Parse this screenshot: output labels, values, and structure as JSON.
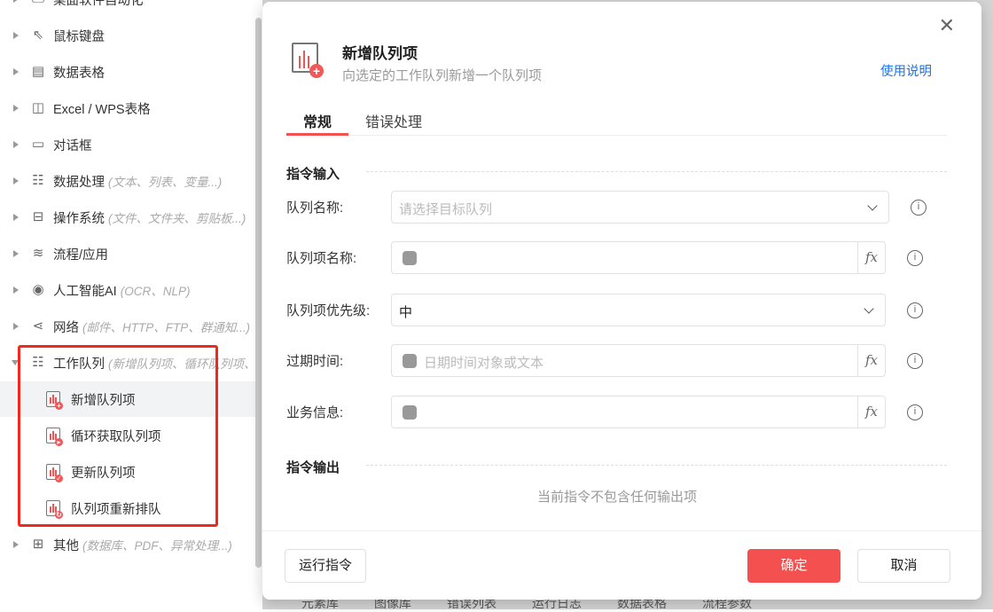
{
  "sidebar": {
    "items": [
      {
        "label": "桌面软件自动化",
        "hint": "",
        "icon": "monitor-icon"
      },
      {
        "label": "鼠标键盘",
        "hint": "",
        "icon": "cursor-icon"
      },
      {
        "label": "数据表格",
        "hint": "",
        "icon": "document-icon"
      },
      {
        "label": "Excel / WPS表格",
        "hint": "",
        "icon": "excel-icon"
      },
      {
        "label": "对话框",
        "hint": "",
        "icon": "dialog-icon"
      },
      {
        "label": "数据处理",
        "hint": "(文本、列表、变量...)",
        "icon": "data-processing-icon"
      },
      {
        "label": "操作系统",
        "hint": "(文件、文件夹、剪贴板...)",
        "icon": "briefcase-icon"
      },
      {
        "label": "流程/应用",
        "hint": "",
        "icon": "layers-icon"
      },
      {
        "label": "人工智能AI",
        "hint": "(OCR、NLP)",
        "icon": "ai-icon"
      },
      {
        "label": "网络",
        "hint": "(邮件、HTTP、FTP、群通知...)",
        "icon": "share-icon"
      },
      {
        "label": "工作队列",
        "hint": "(新增队列项、循环队列项、",
        "icon": "work-queue-icon"
      }
    ],
    "sub_items": [
      {
        "label": "新增队列项",
        "badge": "+"
      },
      {
        "label": "循环获取队列项",
        "badge": "▸"
      },
      {
        "label": "更新队列项",
        "badge": "✓"
      },
      {
        "label": "队列项重新排队",
        "badge": "↻"
      }
    ],
    "last_item": {
      "label": "其他",
      "hint": "(数据库、PDF、异常处理...)",
      "icon": "grid-icon"
    }
  },
  "background_tabs": [
    "元素库",
    "图像库",
    "错误列表",
    "运行日志",
    "数据表格",
    "流程参数"
  ],
  "dialog": {
    "title": "新增队列项",
    "subtitle": "向选定的工作队列新增一个队列项",
    "help_link": "使用说明",
    "tabs": [
      "常规",
      "错误处理"
    ],
    "input_section": "指令输入",
    "fields": [
      {
        "label": "队列名称:",
        "type": "select",
        "value": "",
        "placeholder": "请选择目标队列"
      },
      {
        "label": "队列项名称:",
        "type": "expr",
        "value": "",
        "placeholder": ""
      },
      {
        "label": "队列项优先级:",
        "type": "select",
        "value": "中",
        "placeholder": ""
      },
      {
        "label": "过期时间:",
        "type": "expr",
        "value": "",
        "placeholder": "日期时间对象或文本"
      },
      {
        "label": "业务信息:",
        "type": "expr",
        "value": "",
        "placeholder": ""
      }
    ],
    "fx_label": "fx",
    "info_glyph": "i",
    "output_section": "指令输出",
    "output_empty": "当前指令不包含任何输出项",
    "run_button": "运行指令",
    "ok_button": "确定",
    "cancel_button": "取消"
  },
  "colors": {
    "accent": "#f55050",
    "link": "#1a73e8",
    "highlight_box": "#ee2a1f"
  }
}
